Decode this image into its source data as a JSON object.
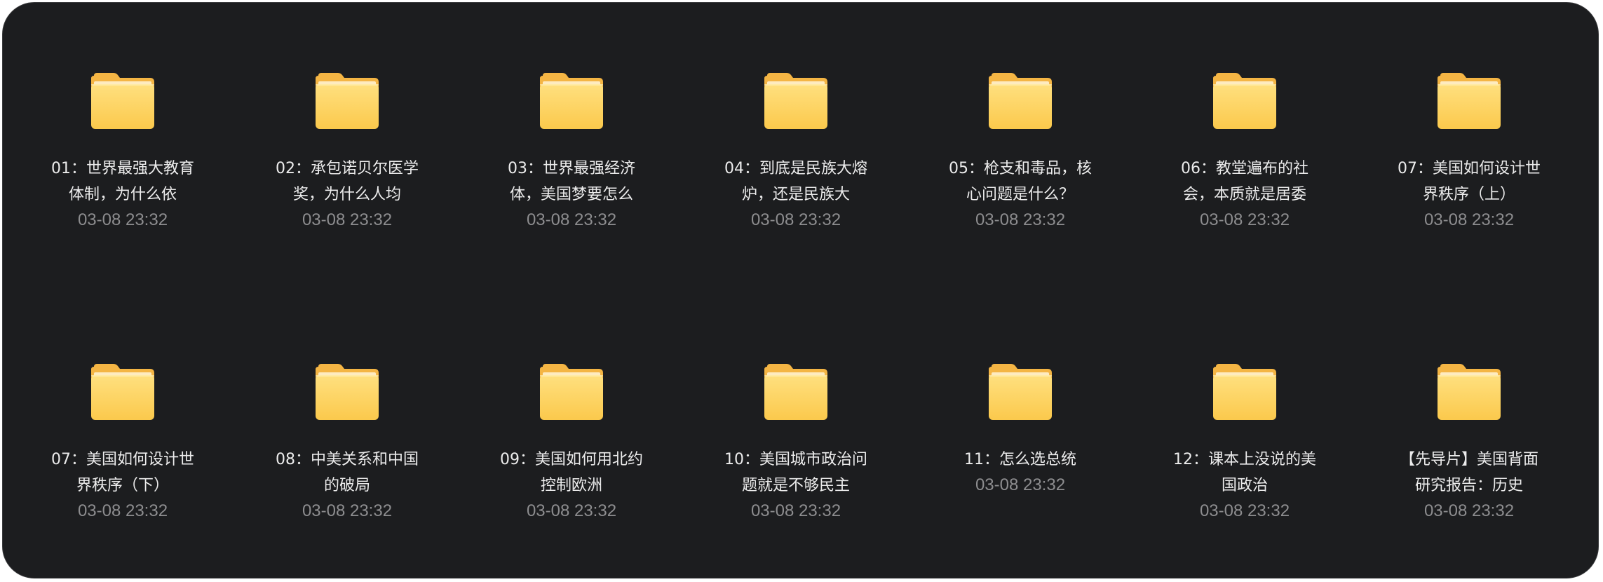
{
  "folders": [
    {
      "name": "01：世界最强大教育体制，为什么依",
      "date": "03-08 23:32"
    },
    {
      "name": "02：承包诺贝尔医学奖，为什么人均",
      "date": "03-08 23:32"
    },
    {
      "name": "03：世界最强经济体，美国梦要怎么",
      "date": "03-08 23:32"
    },
    {
      "name": "04：到底是民族大熔炉，还是民族大",
      "date": "03-08 23:32"
    },
    {
      "name": "05：枪支和毒品，核心问题是什么？",
      "date": "03-08 23:32"
    },
    {
      "name": "06：教堂遍布的社会，本质就是居委",
      "date": "03-08 23:32"
    },
    {
      "name": "07：美国如何设计世界秩序（上）",
      "date": "03-08 23:32"
    },
    {
      "name": "07：美国如何设计世界秩序（下）",
      "date": "03-08 23:32"
    },
    {
      "name": "08：中美关系和中国的破局",
      "date": "03-08 23:32"
    },
    {
      "name": "09：美国如何用北约控制欧洲",
      "date": "03-08 23:32"
    },
    {
      "name": "10：美国城市政治问题就是不够民主",
      "date": "03-08 23:32"
    },
    {
      "name": "11：怎么选总统",
      "date": "03-08 23:32"
    },
    {
      "name": "12：课本上没说的美国政治",
      "date": "03-08 23:32"
    },
    {
      "name": "【先导片】美国背面研究报告：历史",
      "date": "03-08 23:32"
    }
  ],
  "icon": "folder-icon",
  "colors": {
    "background": "#1c1d1f",
    "folder_front": "#fcd15c",
    "folder_back": "#f4b544",
    "name_text": "#ececec",
    "date_text": "#8d8d8f"
  }
}
